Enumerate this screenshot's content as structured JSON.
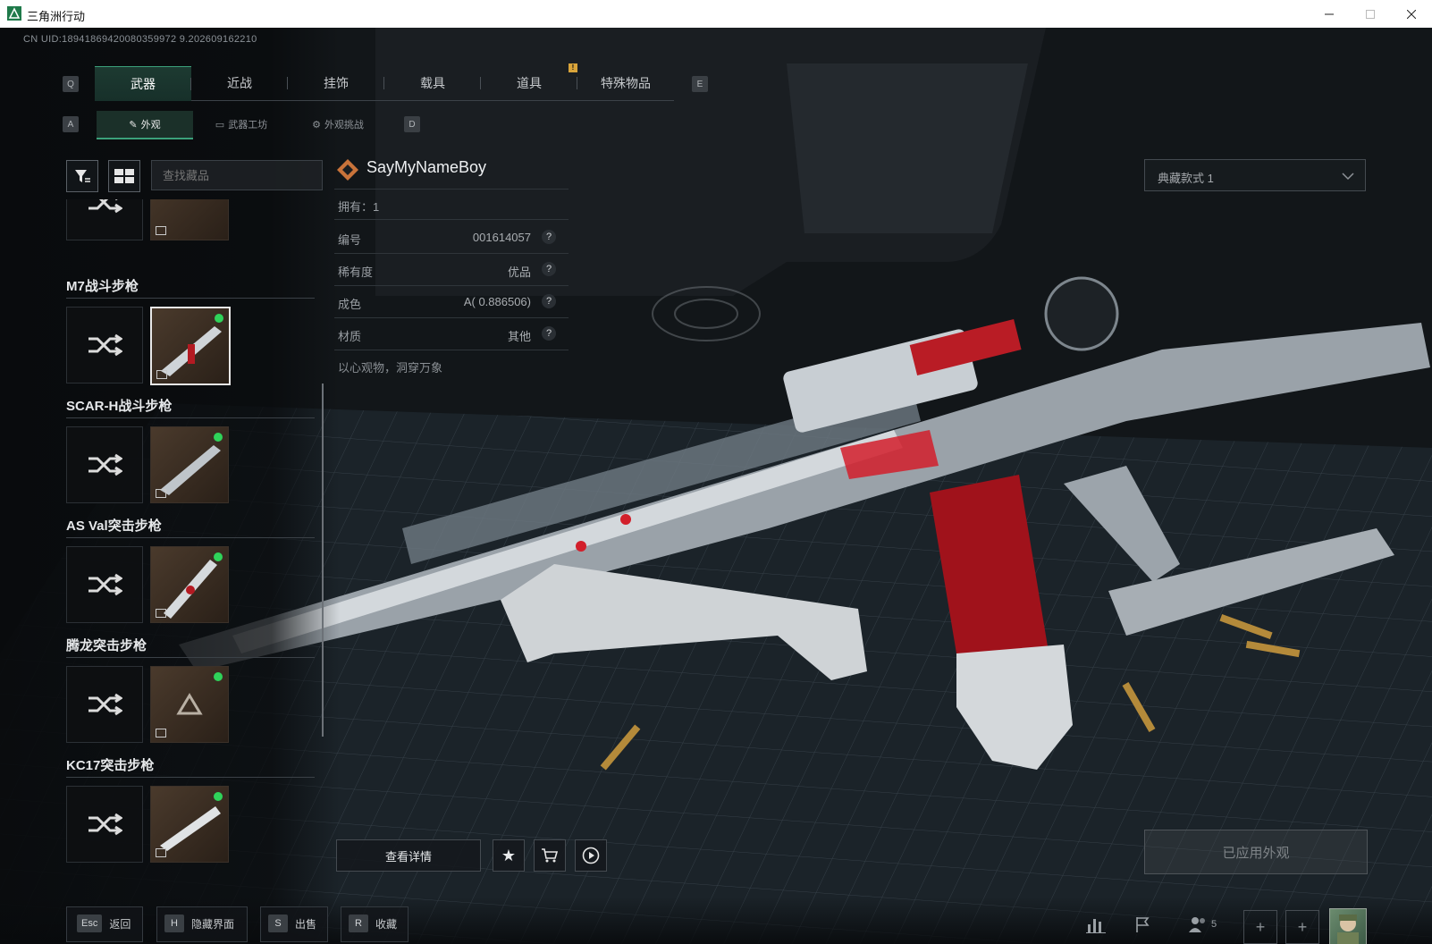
{
  "window": {
    "title": "三角洲行动"
  },
  "uid": "CN UID:18941869420080359972 9.202609162210",
  "keys": {
    "q": "Q",
    "e": "E",
    "a": "A",
    "d": "D"
  },
  "tabs": [
    {
      "label": "武器",
      "active": true
    },
    {
      "label": "近战"
    },
    {
      "label": "挂饰"
    },
    {
      "label": "载具"
    },
    {
      "label": "道具"
    },
    {
      "label": "特殊物品"
    }
  ],
  "warn_badge": "!",
  "subtabs": [
    {
      "label": "外观",
      "icon": "brush-icon",
      "active": true
    },
    {
      "label": "武器工坊",
      "icon": "workshop-icon"
    },
    {
      "label": "外观挑战",
      "icon": "gear-icon"
    }
  ],
  "search": {
    "placeholder": "查找藏品"
  },
  "weapons": [
    {
      "name": "M7战斗步枪",
      "selected": true
    },
    {
      "name": "SCAR-H战斗步枪"
    },
    {
      "name": "AS Val突击步枪"
    },
    {
      "name": "腾龙突击步枪"
    },
    {
      "name": "KC17突击步枪"
    }
  ],
  "detail": {
    "name": "SayMyNameBoy",
    "owned_label": "拥有：",
    "owned_value": "1",
    "rows": [
      {
        "key": "编号",
        "value": "001614057"
      },
      {
        "key": "稀有度",
        "value": "优品"
      },
      {
        "key": "成色",
        "value": "A( 0.886506)"
      },
      {
        "key": "材质",
        "value": "其他"
      }
    ],
    "help": "?",
    "motto": "以心观物，洞穿万象"
  },
  "style_dropdown": {
    "value": "典藏款式 1"
  },
  "actions": {
    "view_details": "查看详情"
  },
  "applied_button": "已应用外观",
  "bottom_hints": [
    {
      "key": "Esc",
      "label": "返回"
    },
    {
      "key": "H",
      "label": "隐藏界面"
    },
    {
      "key": "S",
      "label": "出售"
    },
    {
      "key": "R",
      "label": "收藏"
    }
  ],
  "bottom_right": {
    "friends_count": "5"
  },
  "colors": {
    "accent": "#3ba07a",
    "online": "#2fd35a",
    "warn": "#d9a43a"
  }
}
